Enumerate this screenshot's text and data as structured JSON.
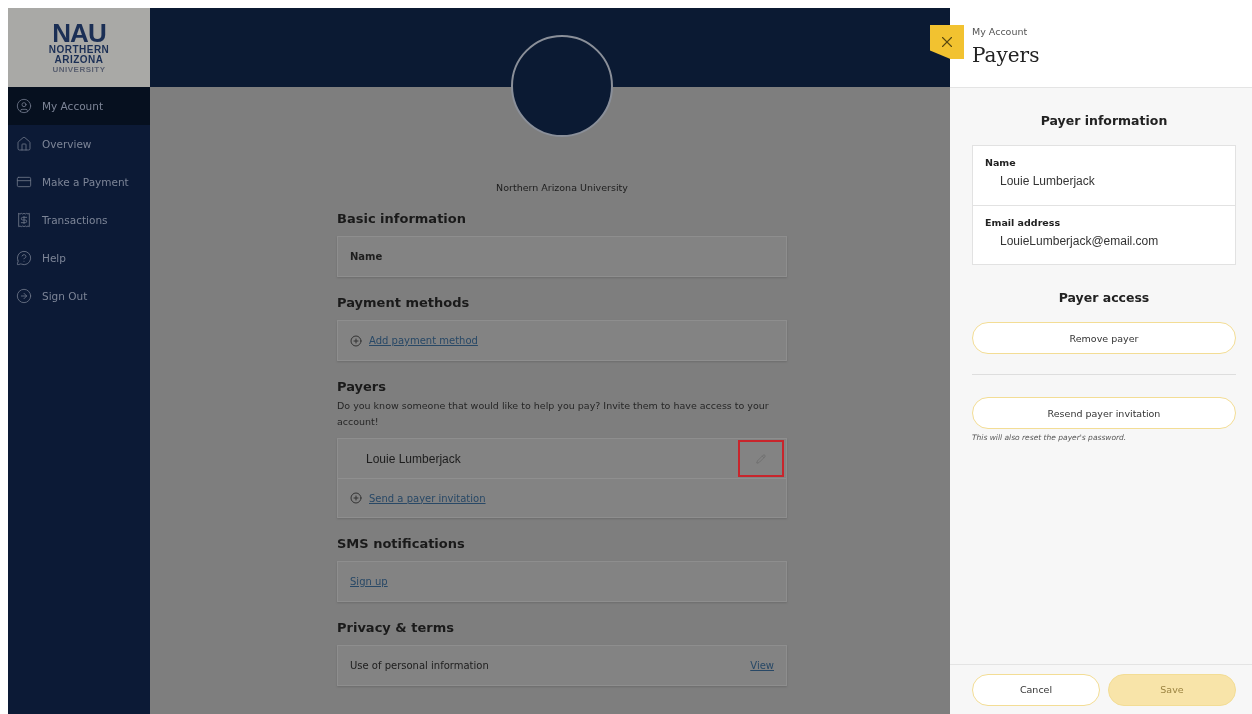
{
  "logo": {
    "mark": "NAU",
    "lines": [
      "NORTHERN",
      "ARIZONA",
      "UNIVERSITY"
    ]
  },
  "sidebar": {
    "items": [
      {
        "label": "My Account",
        "selected": true
      },
      {
        "label": "Overview",
        "selected": false
      },
      {
        "label": "Make a Payment",
        "selected": false
      },
      {
        "label": "Transactions",
        "selected": false
      },
      {
        "label": "Help",
        "selected": false
      },
      {
        "label": "Sign Out",
        "selected": false
      }
    ]
  },
  "profile": {
    "institution": "Northern Arizona University"
  },
  "sections": [
    {
      "title": "Basic information",
      "rows": [
        {
          "kind": "field",
          "label": "Name"
        }
      ]
    },
    {
      "title": "Payment methods",
      "rows": [
        {
          "kind": "add",
          "link": "Add payment method"
        }
      ]
    },
    {
      "title": "Payers",
      "description": "Do you know someone that would like to help you pay? Invite them to have access to your account!",
      "rows": [
        {
          "kind": "payer",
          "name": "Louie Lumberjack",
          "highlighted": true
        },
        {
          "kind": "add",
          "link": "Send a payer invitation"
        }
      ]
    },
    {
      "title": "SMS notifications",
      "rows": [
        {
          "kind": "link",
          "link": "Sign up"
        }
      ]
    },
    {
      "title": "Privacy & terms",
      "rows": [
        {
          "kind": "item",
          "label": "Use of personal information",
          "link": "View"
        }
      ]
    }
  ],
  "panel": {
    "breadcrumb": "My Account",
    "title": "Payers",
    "info_title": "Payer information",
    "fields": [
      {
        "label": "Name",
        "value": "Louie Lumberjack"
      },
      {
        "label": "Email address",
        "value": "LouieLumberjack@email.com"
      }
    ],
    "access_title": "Payer access",
    "remove_button": "Remove payer",
    "resend_button": "Resend payer invitation",
    "resend_note": "This will also reset the payer's password.",
    "footer": [
      {
        "label": "Cancel",
        "disabled": false,
        "primary": false
      },
      {
        "label": "Save",
        "disabled": true,
        "primary": true
      }
    ]
  }
}
